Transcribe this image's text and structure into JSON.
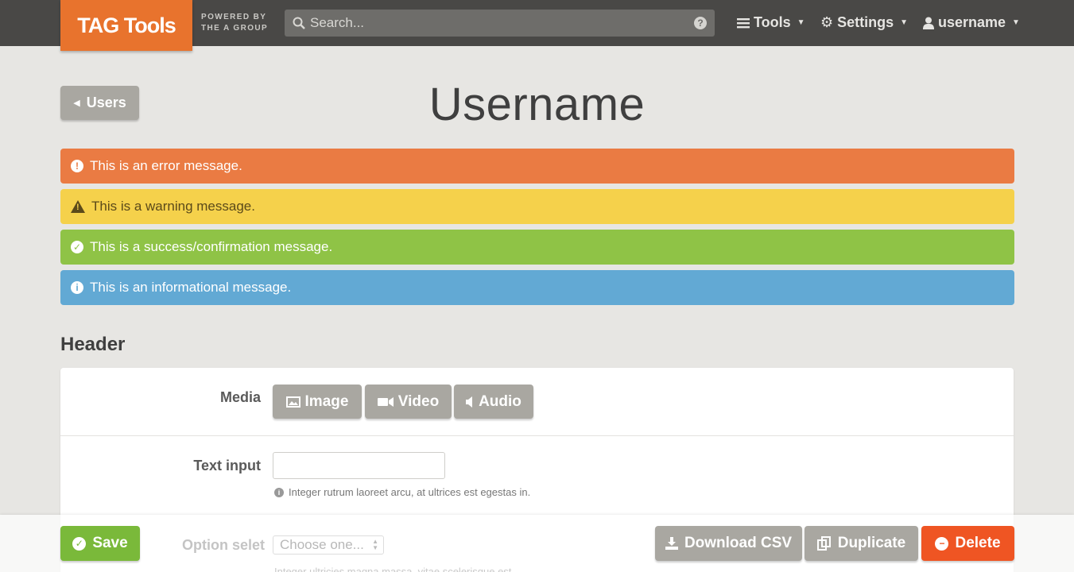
{
  "brand": {
    "logo_text": "TAG Tools",
    "powered_line1": "POWERED BY",
    "powered_line2": "THE A GROUP",
    "accent_color": "#e8732d"
  },
  "search": {
    "placeholder": "Search...",
    "help_icon": "?"
  },
  "nav": {
    "tools": "Tools",
    "settings": "Settings",
    "user": "username"
  },
  "back_button": "Users",
  "page_title": "Username",
  "alerts": {
    "error": "This is an error message.",
    "warning": "This is a warning message.",
    "success": "This is a success/confirmation message.",
    "info": "This is an informational message."
  },
  "section_header": "Header",
  "form": {
    "media_label": "Media",
    "media_buttons": [
      "Image",
      "Video",
      "Audio"
    ],
    "text_input_label": "Text input",
    "text_input_value": "",
    "text_input_hint": "Integer rutrum laoreet arcu, at ultrices est egestas in.",
    "option_label": "Option selet",
    "option_value": "Choose one...",
    "option_hint": "Integer ultricies magna massa, vitae scelerisque est."
  },
  "actions": {
    "save": "Save",
    "download_csv": "Download CSV",
    "duplicate": "Duplicate",
    "delete": "Delete"
  },
  "colors": {
    "error": "#ea7b43",
    "warning": "#f5d14b",
    "success": "#8fc346",
    "info": "#62a9d4",
    "save": "#7ab93a",
    "delete": "#ef5523",
    "neutral_button": "#a9a7a1"
  }
}
